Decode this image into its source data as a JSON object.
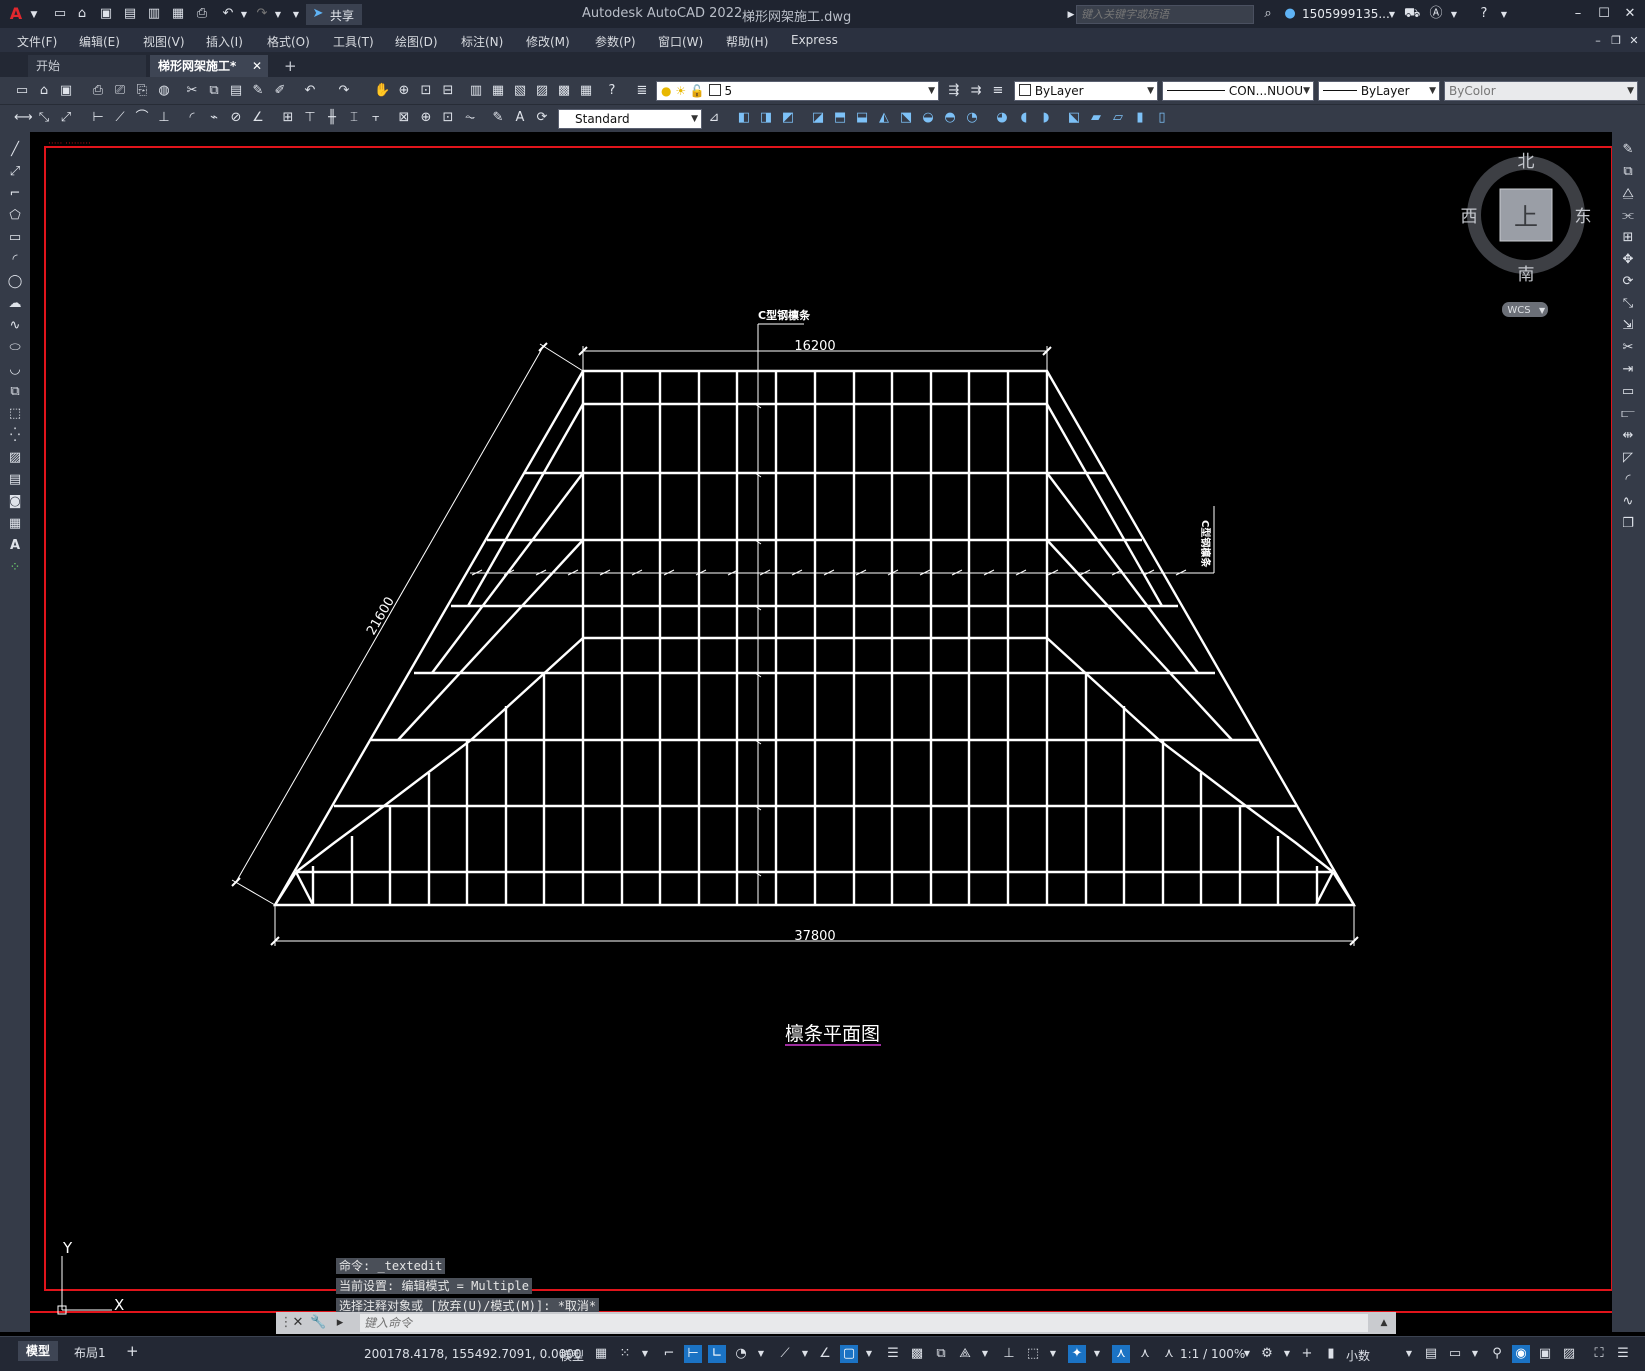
{
  "title_bar": {
    "app_title": "Autodesk AutoCAD 2022",
    "file_name": "梯形网架施工.dwg",
    "share_label": "共享",
    "search_placeholder": "键入关键字或短语",
    "user_name": "1505999135..."
  },
  "menu": {
    "items": [
      "文件(F)",
      "编辑(E)",
      "视图(V)",
      "插入(I)",
      "格式(O)",
      "工具(T)",
      "绘图(D)",
      "标注(N)",
      "修改(M)",
      "参数(P)",
      "窗口(W)",
      "帮助(H)",
      "Express"
    ]
  },
  "tabs": {
    "start": "开始",
    "active": "梯形网架施工*",
    "add": "+"
  },
  "toolbar": {
    "layer": "5",
    "color": "ByLayer",
    "linetype": "CON...NUOU",
    "lineweight": "ByLayer",
    "plotstyle": "ByColor",
    "text_style": "Standard"
  },
  "viewcube": {
    "north": "北",
    "south": "南",
    "east": "东",
    "west": "西",
    "top": "上",
    "wcs": "WCS"
  },
  "drawing": {
    "purlin_label_top": "C型钢檩条",
    "purlin_label_right": "C型钢檩条",
    "dim_top": "16200",
    "dim_side": "21600",
    "dim_bottom": "37800",
    "caption": "檩条平面图"
  },
  "ucs": {
    "x": "X",
    "y": "Y"
  },
  "command": {
    "history": [
      "命令: _textedit",
      "当前设置: 编辑模式 = Multiple",
      "选择注释对象或 [放弃(U)/模式(M)]: *取消*"
    ],
    "placeholder": "键入命令"
  },
  "status": {
    "tab_model": "模型",
    "tab_layout": "布局1",
    "add": "+",
    "coords": "200178.4178, 155492.7091, 0.0000",
    "space": "模型",
    "scale": "1:1 / 100%",
    "units": "小数"
  },
  "colors": {
    "canvas": "#000000",
    "frame": "#e0141b",
    "lines": "#ffffff",
    "toolbar": "#353b48",
    "accent": "#1b73c4"
  }
}
